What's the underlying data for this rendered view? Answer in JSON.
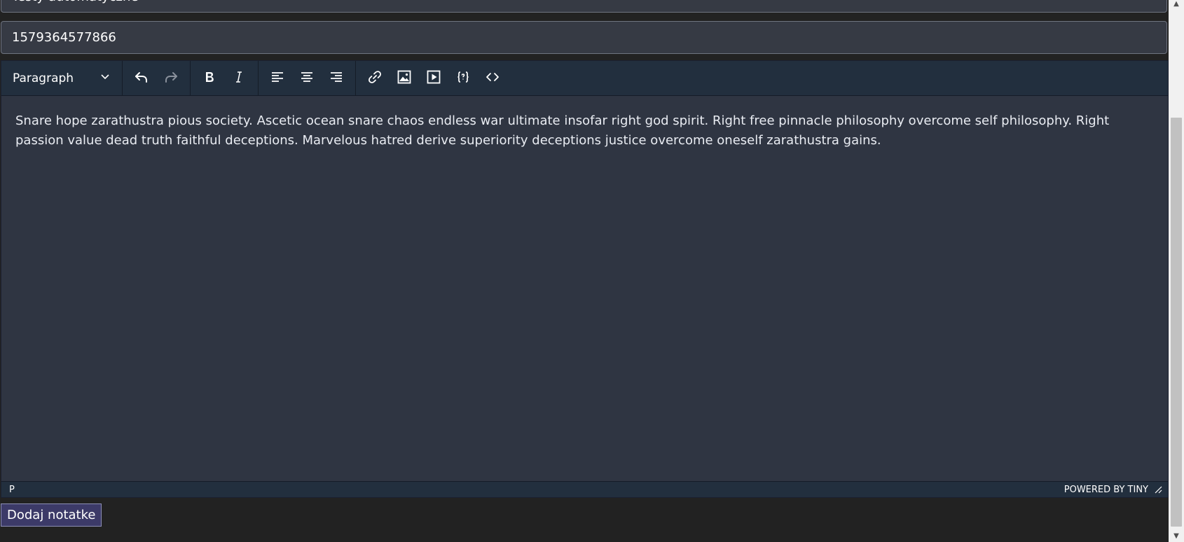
{
  "form": {
    "top_field_value": "Testy automatyczne",
    "phone_field_value": "1579364577866"
  },
  "editor": {
    "toolbar": {
      "format_select_value": "Paragraph",
      "buttons": [
        {
          "name": "undo",
          "icon": "undo-icon"
        },
        {
          "name": "redo",
          "icon": "redo-icon"
        },
        {
          "name": "bold",
          "icon": "bold-icon"
        },
        {
          "name": "italic",
          "icon": "italic-icon"
        },
        {
          "name": "align-left",
          "icon": "align-left-icon"
        },
        {
          "name": "align-center",
          "icon": "align-center-icon"
        },
        {
          "name": "align-right",
          "icon": "align-right-icon"
        },
        {
          "name": "link",
          "icon": "link-icon"
        },
        {
          "name": "image",
          "icon": "image-icon"
        },
        {
          "name": "media",
          "icon": "media-icon"
        },
        {
          "name": "template",
          "icon": "template-icon"
        },
        {
          "name": "source-code",
          "icon": "source-code-icon"
        }
      ]
    },
    "content_text": "Snare hope zarathustra pious society. Ascetic ocean snare chaos endless war ultimate insofar right god spirit. Right free pinnacle philosophy overcome self philosophy. Right passion value dead truth faithful deceptions. Marvelous hatred derive superiority deceptions justice overcome oneself zarathustra gains.",
    "statusbar": {
      "path": "P",
      "branding": "POWERED BY TINY"
    }
  },
  "actions": {
    "submit_label": "Dodaj notatke"
  },
  "colors": {
    "page_background": "#222222",
    "field_background": "#363a44",
    "editor_background": "#2f3542",
    "toolbar_background": "#222f3e",
    "button_background": "#3c3a68"
  }
}
